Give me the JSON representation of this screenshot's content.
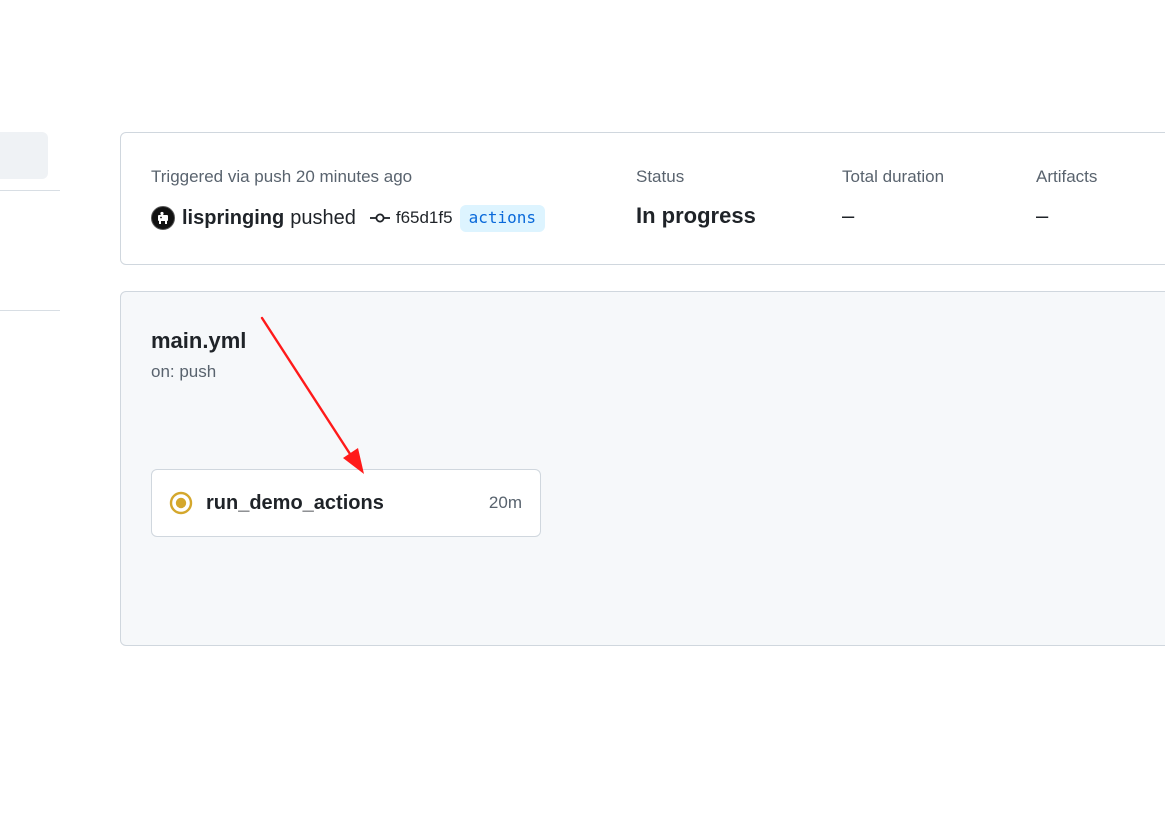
{
  "summary": {
    "triggered_text": "Triggered via push 20 minutes ago",
    "actor": "lispringing",
    "action": "pushed",
    "commit_sha": "f65d1f5",
    "branch": "actions",
    "status_label": "Status",
    "status_value": "In progress",
    "duration_label": "Total duration",
    "duration_value": "–",
    "artifacts_label": "Artifacts",
    "artifacts_value": "–"
  },
  "workflow": {
    "name": "main.yml",
    "trigger": "on: push",
    "jobs": [
      {
        "name": "run_demo_actions",
        "duration": "20m",
        "status": "in-progress",
        "status_color": "#d4a72c"
      }
    ]
  },
  "annotation": {
    "arrow_color": "#ff1a1a"
  },
  "colors": {
    "panel_bg": "#f6f8fa",
    "border": "#d0d7de",
    "branch_bg": "#ddf4ff",
    "branch_text": "#0969da"
  }
}
